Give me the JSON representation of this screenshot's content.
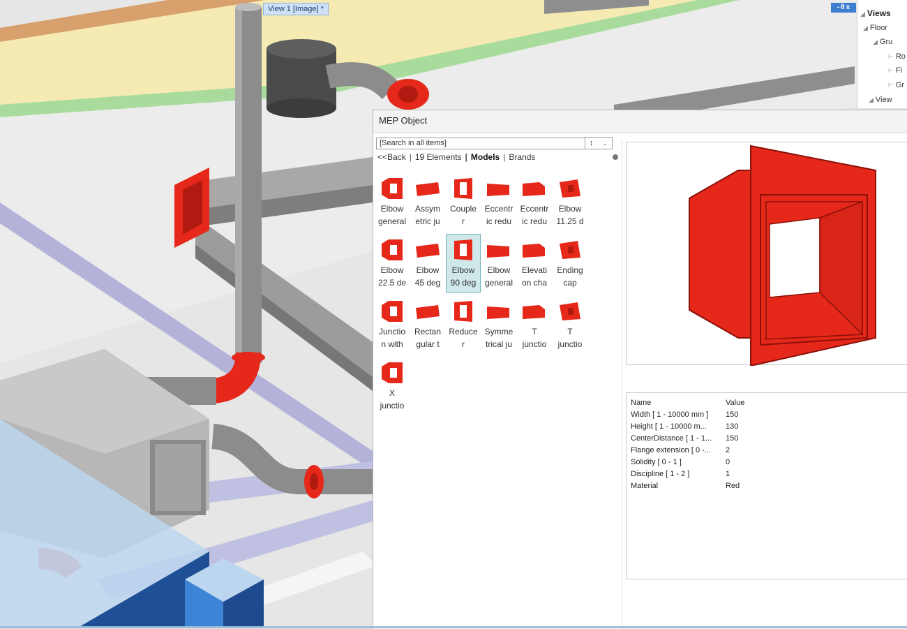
{
  "view_tab": "View 1 [Image] *",
  "window_controls": "- θ x",
  "tree": {
    "title": "Views",
    "rows": [
      "Floor",
      "Gru",
      "Ro",
      "Fi",
      "Gr",
      "View"
    ]
  },
  "dialog": {
    "title": "MEP Object",
    "search_placeholder": "[Search in all items]",
    "sort_symbol": "↕",
    "nav": {
      "back": "<<Back",
      "elements": "19 Elements",
      "models": "Models",
      "brands": "Brands"
    },
    "items": [
      {
        "l1": "Elbow",
        "l2": "general"
      },
      {
        "l1": "Assym",
        "l2": "etric ju"
      },
      {
        "l1": "Couple",
        "l2": "r"
      },
      {
        "l1": "Eccentr",
        "l2": "ic redu"
      },
      {
        "l1": "Eccentr",
        "l2": "ic redu"
      },
      {
        "l1": "Elbow",
        "l2": "11.25 d"
      },
      {
        "l1": "Elbow",
        "l2": "22.5 de"
      },
      {
        "l1": "Elbow",
        "l2": "45 deg"
      },
      {
        "l1": "Elbow",
        "l2": "90 deg"
      },
      {
        "l1": "Elbow",
        "l2": "general"
      },
      {
        "l1": "Elevati",
        "l2": "on cha"
      },
      {
        "l1": "Ending",
        "l2": "cap"
      },
      {
        "l1": "Junctio",
        "l2": "n with"
      },
      {
        "l1": "Rectan",
        "l2": "gular t"
      },
      {
        "l1": "Reduce",
        "l2": "r"
      },
      {
        "l1": "Symme",
        "l2": "trical ju"
      },
      {
        "l1": "T",
        "l2": "junctio"
      },
      {
        "l1": "T",
        "l2": "junctio"
      },
      {
        "l1": "X",
        "l2": "junctio"
      }
    ],
    "selected_item": 8,
    "properties": {
      "header_name": "Name",
      "header_value": "Value",
      "rows": [
        {
          "name": "Width [ 1 - 10000 mm ]",
          "value": "150"
        },
        {
          "name": "Height [ 1 - 10000 m...",
          "value": "130"
        },
        {
          "name": "CenterDistance [ 1 - 1...",
          "value": "150"
        },
        {
          "name": "Flange extension [ 0 -...",
          "value": "2"
        },
        {
          "name": "Solidity [ 0 - 1 ]",
          "value": "0"
        },
        {
          "name": "Discipline [ 1 - 2 ]",
          "value": "1"
        },
        {
          "name": "Material",
          "value": "Red"
        }
      ]
    }
  },
  "colors": {
    "fitting_red": "#e5281a",
    "duct_gray": "#8c8c8c",
    "selection": "#cfe8ea",
    "accent_blue": "#1f5fae"
  }
}
